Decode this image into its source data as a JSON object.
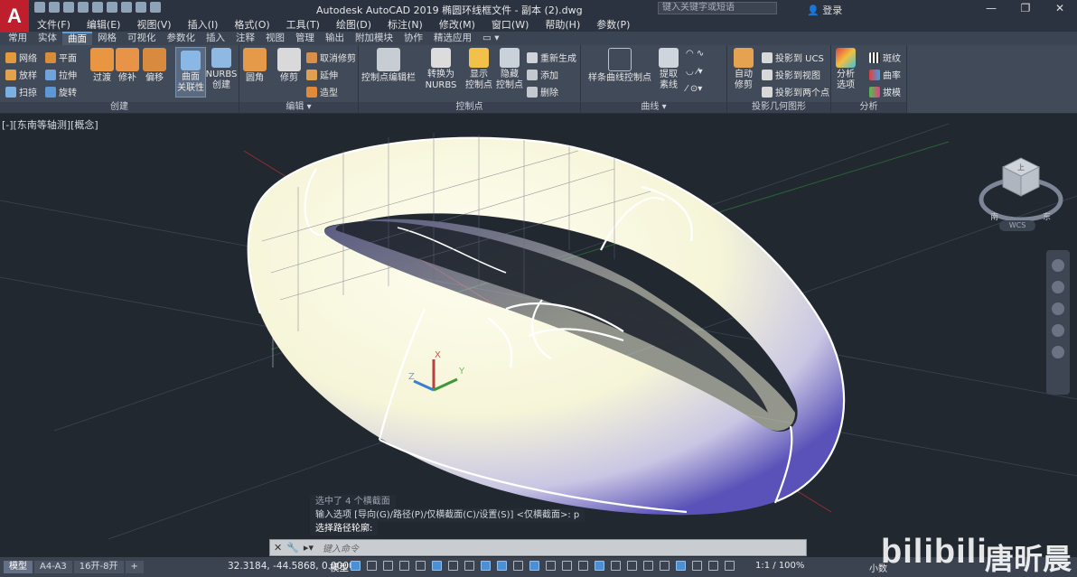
{
  "window": {
    "title": "Autodesk AutoCAD 2019    椭圆环线框文件 - 副本 (2).dwg",
    "search_placeholder": "键入关键字或短语",
    "login_label": "登录",
    "minimize": "—",
    "restore": "❐",
    "close": "✕"
  },
  "menubar": {
    "items": [
      "文件(F)",
      "编辑(E)",
      "视图(V)",
      "插入(I)",
      "格式(O)",
      "工具(T)",
      "绘图(D)",
      "标注(N)",
      "修改(M)",
      "窗口(W)",
      "帮助(H)",
      "参数(P)"
    ]
  },
  "ribbon_tabs": {
    "items": [
      "常用",
      "实体",
      "曲面",
      "网格",
      "可视化",
      "参数化",
      "插入",
      "注释",
      "视图",
      "管理",
      "输出",
      "附加模块",
      "协作",
      "精选应用"
    ],
    "active": "曲面"
  },
  "ribbon": {
    "create": {
      "title": "创建",
      "small": [
        "网络",
        "平面",
        "放样",
        "拉伸",
        "扫掠",
        "旋转"
      ],
      "big": [
        "过渡",
        "修补",
        "偏移"
      ],
      "surface_assoc": "曲面\n关联性",
      "nurbs": "NURBS\n创建"
    },
    "edit": {
      "title": "编辑",
      "big": [
        "圆角",
        "修剪"
      ],
      "small": [
        "取消修剪",
        "延伸",
        "造型"
      ]
    },
    "controlpoints": {
      "title": "控制点",
      "editbar": "控制点编辑栏",
      "to_nurbs": "转换为\nNURBS",
      "show": "显示\n控制点",
      "hide": "隐藏\n控制点",
      "small": [
        "重新生成",
        "添加",
        "删除"
      ]
    },
    "curves": {
      "title": "曲线",
      "spline": "样条曲线控制点",
      "extract": "提取\n素线"
    },
    "projection": {
      "title": "投影几何图形",
      "auto": "自动\n修剪",
      "small": [
        "投影到 UCS",
        "投影到视图",
        "投影到两个点"
      ]
    },
    "analysis": {
      "title": "分析",
      "big": "分析\n选项",
      "small": [
        "斑纹",
        "曲率",
        "拔模"
      ]
    }
  },
  "viewport": {
    "label": "[-][东南等轴测][概念]",
    "wcs": "WCS",
    "cube_face": "上",
    "cube_dirs": {
      "south": "南",
      "east": "东"
    }
  },
  "command": {
    "history": [
      "选中了 4 个横截面",
      "输入选项 [导向(G)/路径(P)/仅横截面(C)/设置(S)] <仅横截面>: p",
      "选择路径轮廓:"
    ],
    "placeholder": "键入命令"
  },
  "statusbar": {
    "layout_tabs": [
      "模型",
      "A4-A3",
      "16开-8开"
    ],
    "add_tab": "+",
    "coords": "32.3184, -44.5868, 0.0000",
    "mode": "模型",
    "scale": "1:1 / 100%",
    "decimal": "小数"
  },
  "watermark": {
    "brand": "bilibili",
    "name": "唐昕晨"
  },
  "colors": {
    "accent": "#5aa0e0",
    "logo": "#bf1e2d",
    "viewport_bg": "#212830",
    "surface_light": "#fbfbe4",
    "surface_shadow": "#5a52b8"
  }
}
